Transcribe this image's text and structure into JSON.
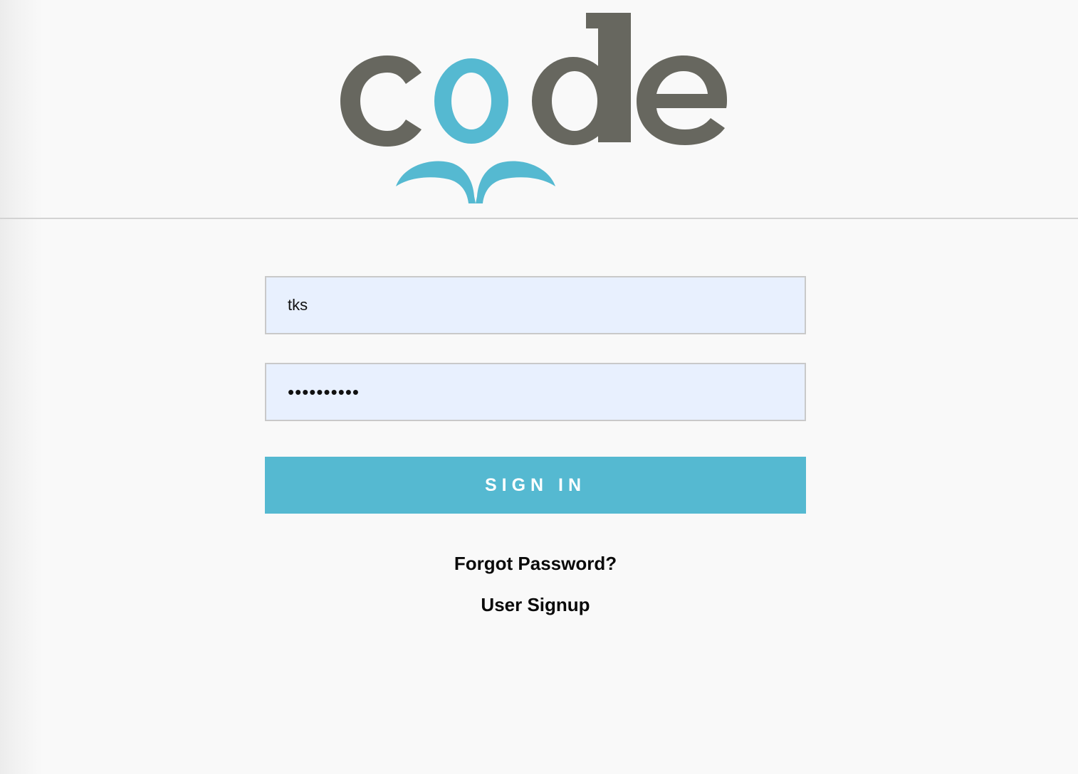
{
  "logo": {
    "text": "code",
    "colors": {
      "gray": "#67675f",
      "blue": "#55b9d1"
    }
  },
  "login": {
    "username": {
      "value": "tks"
    },
    "password": {
      "value": "••••••••••"
    },
    "signin_label": "SIGN IN"
  },
  "links": {
    "forgot_password": "Forgot Password?",
    "user_signup": "User Signup"
  },
  "colors": {
    "accent": "#55b9d1",
    "input_bg": "#e8f0fe",
    "page_bg": "#f9f9f9",
    "divider": "#d3d3d3"
  }
}
